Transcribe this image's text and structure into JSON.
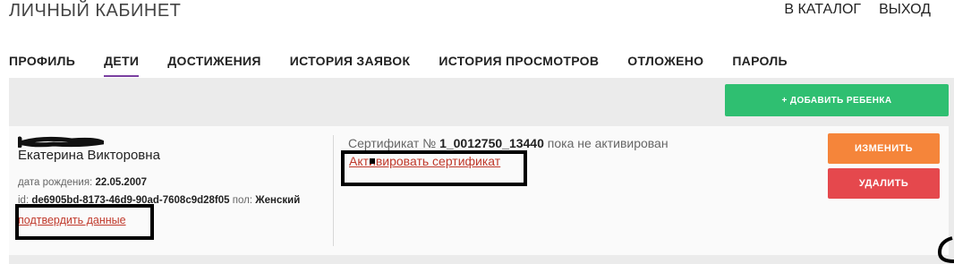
{
  "header": {
    "title": "ЛИЧНЫЙ КАБИНЕТ",
    "catalog_link": "В КАТАЛОГ",
    "logout_link": "ВЫХОД"
  },
  "tabs": [
    {
      "label": "ПРОФИЛЬ",
      "active": false
    },
    {
      "label": "ДЕТИ",
      "active": true
    },
    {
      "label": "ДОСТИЖЕНИЯ",
      "active": false
    },
    {
      "label": "ИСТОРИЯ ЗАЯВОК",
      "active": false
    },
    {
      "label": "ИСТОРИЯ ПРОСМОТРОВ",
      "active": false
    },
    {
      "label": "ОТЛОЖЕНО",
      "active": false
    },
    {
      "label": "ПАРОЛЬ",
      "active": false
    }
  ],
  "add_child_button": "+ ДОБАВИТЬ РЕБЕНКА",
  "child": {
    "name": "Екатерина Викторовна",
    "dob_label": "дата рождения:",
    "dob_value": "22.05.2007",
    "id_label": "id:",
    "id_value": "de6905bd-8173-46d9-90ad-7608c9d28f05",
    "gender_label": "пол:",
    "gender_value": "Женский",
    "confirm_link": "подтвердить данные"
  },
  "certificate": {
    "prefix": "Сертификат №",
    "number": "1_0012750_13440",
    "status": "пока не активирован",
    "activate_link": "Активировать сертификат"
  },
  "actions": {
    "edit_label": "ИЗМЕНИТЬ",
    "delete_label": "УДАЛИТЬ"
  },
  "colors": {
    "accent_tab": "#7a3fa0",
    "add_button": "#2fbf71",
    "edit_button": "#f5853a",
    "delete_button": "#e5484d",
    "link": "#c0392b"
  }
}
